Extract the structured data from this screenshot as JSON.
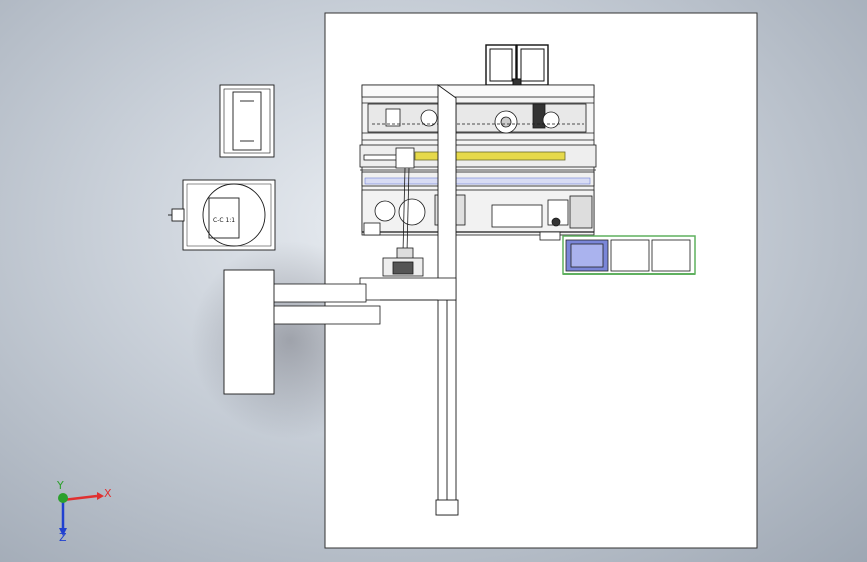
{
  "viewport": {
    "background": "#c4cbd4"
  },
  "drawing": {
    "sheet_color": "#ffffff",
    "line_color": "#1a1a1a",
    "accent_yellow": "#e6d94a",
    "accent_blue": "#6f7fd6",
    "accent_green": "#5fb05f",
    "notes": {
      "left_view_label": "C-C 1:1"
    }
  },
  "triad": {
    "x_label": "X",
    "y_label": "Y",
    "z_label": "Z",
    "x_color": "#e03030",
    "y_color": "#2ca02c",
    "z_color": "#2040d0"
  }
}
